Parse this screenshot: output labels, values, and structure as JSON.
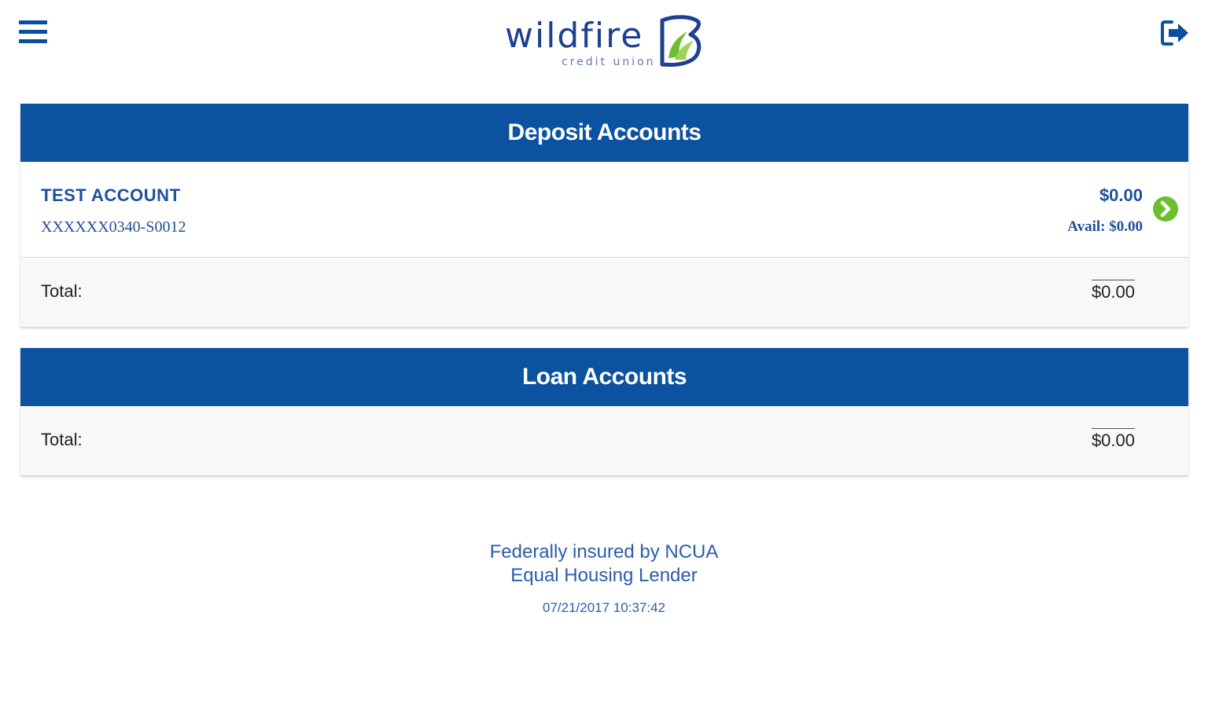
{
  "header": {
    "brand_name": "wildfire",
    "brand_sub": "credit union",
    "menu_icon": "hamburger-menu-icon",
    "logout_icon": "sign-out-icon"
  },
  "deposit": {
    "title": "Deposit Accounts",
    "accounts": [
      {
        "name": "TEST ACCOUNT",
        "number": "XXXXXX0340-S0012",
        "balance": "$0.00",
        "available": "Avail: $0.00",
        "icon": "chevron-right-circle-icon"
      }
    ],
    "total_label": "Total:",
    "total_value": "$0.00"
  },
  "loan": {
    "title": "Loan Accounts",
    "total_label": "Total:",
    "total_value": "$0.00"
  },
  "footer": {
    "line1": "Federally insured by NCUA",
    "line2": "Equal Housing Lender",
    "timestamp": "07/21/2017 10:37:42"
  },
  "colors": {
    "panel_header": "#0b52a0",
    "brand_blue": "#1f3f8f",
    "accent_green": "#6cbf2c"
  }
}
